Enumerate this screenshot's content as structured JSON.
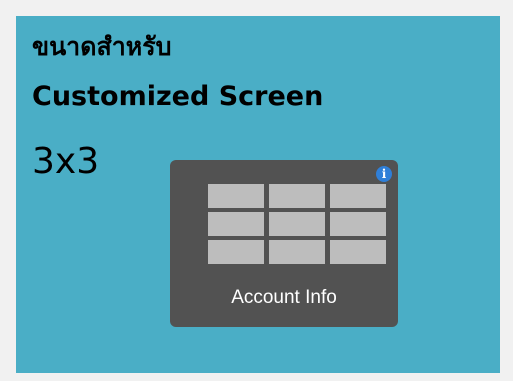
{
  "title": {
    "line1": "ขนาดสำหรับ",
    "line2": "Customized Screen"
  },
  "size_label": "3x3",
  "widget": {
    "label": "Account Info",
    "info_icon": "info-icon",
    "info_glyph": "i",
    "grid": {
      "rows": 3,
      "columns": 3
    }
  },
  "colors": {
    "panel_background": "#4aaec6",
    "page_background": "#f1f1f1",
    "widget_background": "#525252",
    "grid_cell": "#bdbdbd",
    "info_icon": "#2f7fd8"
  }
}
